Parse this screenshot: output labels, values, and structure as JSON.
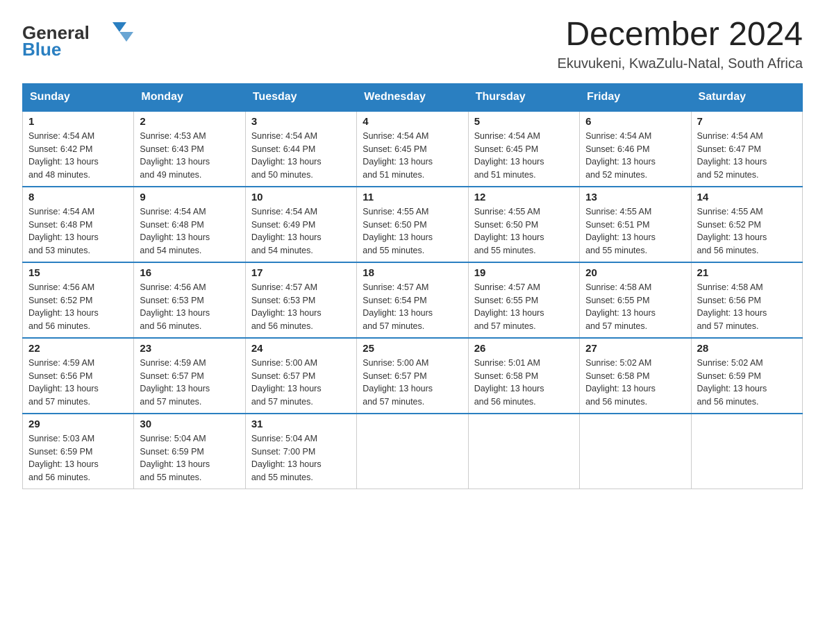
{
  "header": {
    "logo_text_general": "General",
    "logo_text_blue": "Blue",
    "month_title": "December 2024",
    "location": "Ekuvukeni, KwaZulu-Natal, South Africa"
  },
  "weekdays": [
    "Sunday",
    "Monday",
    "Tuesday",
    "Wednesday",
    "Thursday",
    "Friday",
    "Saturday"
  ],
  "weeks": [
    [
      {
        "day": "1",
        "sunrise": "4:54 AM",
        "sunset": "6:42 PM",
        "daylight": "13 hours and 48 minutes."
      },
      {
        "day": "2",
        "sunrise": "4:53 AM",
        "sunset": "6:43 PM",
        "daylight": "13 hours and 49 minutes."
      },
      {
        "day": "3",
        "sunrise": "4:54 AM",
        "sunset": "6:44 PM",
        "daylight": "13 hours and 50 minutes."
      },
      {
        "day": "4",
        "sunrise": "4:54 AM",
        "sunset": "6:45 PM",
        "daylight": "13 hours and 51 minutes."
      },
      {
        "day": "5",
        "sunrise": "4:54 AM",
        "sunset": "6:45 PM",
        "daylight": "13 hours and 51 minutes."
      },
      {
        "day": "6",
        "sunrise": "4:54 AM",
        "sunset": "6:46 PM",
        "daylight": "13 hours and 52 minutes."
      },
      {
        "day": "7",
        "sunrise": "4:54 AM",
        "sunset": "6:47 PM",
        "daylight": "13 hours and 52 minutes."
      }
    ],
    [
      {
        "day": "8",
        "sunrise": "4:54 AM",
        "sunset": "6:48 PM",
        "daylight": "13 hours and 53 minutes."
      },
      {
        "day": "9",
        "sunrise": "4:54 AM",
        "sunset": "6:48 PM",
        "daylight": "13 hours and 54 minutes."
      },
      {
        "day": "10",
        "sunrise": "4:54 AM",
        "sunset": "6:49 PM",
        "daylight": "13 hours and 54 minutes."
      },
      {
        "day": "11",
        "sunrise": "4:55 AM",
        "sunset": "6:50 PM",
        "daylight": "13 hours and 55 minutes."
      },
      {
        "day": "12",
        "sunrise": "4:55 AM",
        "sunset": "6:50 PM",
        "daylight": "13 hours and 55 minutes."
      },
      {
        "day": "13",
        "sunrise": "4:55 AM",
        "sunset": "6:51 PM",
        "daylight": "13 hours and 55 minutes."
      },
      {
        "day": "14",
        "sunrise": "4:55 AM",
        "sunset": "6:52 PM",
        "daylight": "13 hours and 56 minutes."
      }
    ],
    [
      {
        "day": "15",
        "sunrise": "4:56 AM",
        "sunset": "6:52 PM",
        "daylight": "13 hours and 56 minutes."
      },
      {
        "day": "16",
        "sunrise": "4:56 AM",
        "sunset": "6:53 PM",
        "daylight": "13 hours and 56 minutes."
      },
      {
        "day": "17",
        "sunrise": "4:57 AM",
        "sunset": "6:53 PM",
        "daylight": "13 hours and 56 minutes."
      },
      {
        "day": "18",
        "sunrise": "4:57 AM",
        "sunset": "6:54 PM",
        "daylight": "13 hours and 57 minutes."
      },
      {
        "day": "19",
        "sunrise": "4:57 AM",
        "sunset": "6:55 PM",
        "daylight": "13 hours and 57 minutes."
      },
      {
        "day": "20",
        "sunrise": "4:58 AM",
        "sunset": "6:55 PM",
        "daylight": "13 hours and 57 minutes."
      },
      {
        "day": "21",
        "sunrise": "4:58 AM",
        "sunset": "6:56 PM",
        "daylight": "13 hours and 57 minutes."
      }
    ],
    [
      {
        "day": "22",
        "sunrise": "4:59 AM",
        "sunset": "6:56 PM",
        "daylight": "13 hours and 57 minutes."
      },
      {
        "day": "23",
        "sunrise": "4:59 AM",
        "sunset": "6:57 PM",
        "daylight": "13 hours and 57 minutes."
      },
      {
        "day": "24",
        "sunrise": "5:00 AM",
        "sunset": "6:57 PM",
        "daylight": "13 hours and 57 minutes."
      },
      {
        "day": "25",
        "sunrise": "5:00 AM",
        "sunset": "6:57 PM",
        "daylight": "13 hours and 57 minutes."
      },
      {
        "day": "26",
        "sunrise": "5:01 AM",
        "sunset": "6:58 PM",
        "daylight": "13 hours and 56 minutes."
      },
      {
        "day": "27",
        "sunrise": "5:02 AM",
        "sunset": "6:58 PM",
        "daylight": "13 hours and 56 minutes."
      },
      {
        "day": "28",
        "sunrise": "5:02 AM",
        "sunset": "6:59 PM",
        "daylight": "13 hours and 56 minutes."
      }
    ],
    [
      {
        "day": "29",
        "sunrise": "5:03 AM",
        "sunset": "6:59 PM",
        "daylight": "13 hours and 56 minutes."
      },
      {
        "day": "30",
        "sunrise": "5:04 AM",
        "sunset": "6:59 PM",
        "daylight": "13 hours and 55 minutes."
      },
      {
        "day": "31",
        "sunrise": "5:04 AM",
        "sunset": "7:00 PM",
        "daylight": "13 hours and 55 minutes."
      },
      null,
      null,
      null,
      null
    ]
  ],
  "labels": {
    "sunrise_prefix": "Sunrise: ",
    "sunset_prefix": "Sunset: ",
    "daylight_prefix": "Daylight: "
  }
}
